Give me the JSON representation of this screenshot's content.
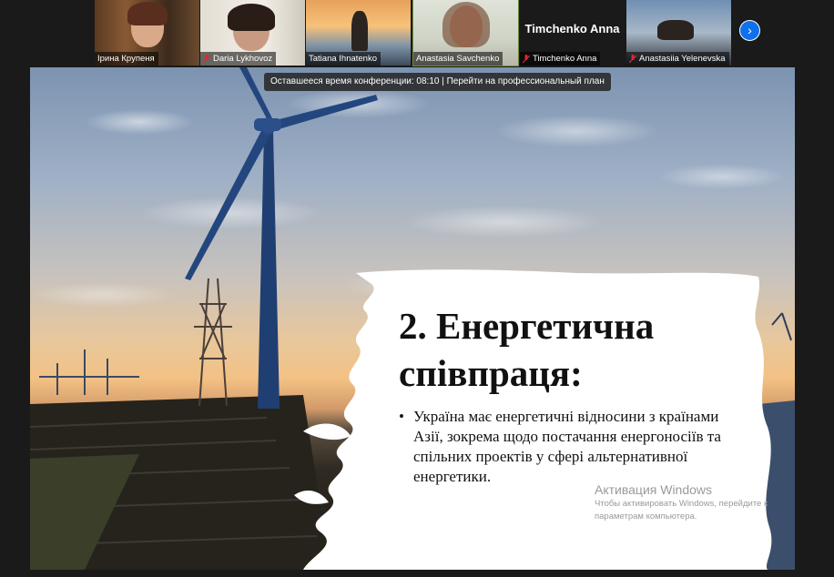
{
  "participants": [
    {
      "name": "Ірина Крупеня",
      "muted": false
    },
    {
      "name": "Daria Lykhovoz",
      "muted": true
    },
    {
      "name": "Tatiana Ihnatenko",
      "muted": false
    },
    {
      "name": "Anastasia Savchenko",
      "muted": false
    },
    {
      "name": "Timchenko Anna",
      "muted": true,
      "display_name": "Timchenko Anna"
    },
    {
      "name": "Anastasiia Yelenevska",
      "muted": true
    }
  ],
  "banner_text": "Оставшееся время конференции: 08:10 | Перейти на профессиональный план",
  "slide": {
    "title_line1": "2. Енергетична",
    "title_line2": "співпраця:",
    "bullet": "Україна має енергетичні відносини з країнами Азії, зокрема щодо постачання енергоносіїв та спільних проектів у сфері альтернативної енергетики."
  },
  "watermark": {
    "title": "Активация Windows",
    "subtitle": "Чтобы активировать Windows, перейдите к параметрам компьютера."
  },
  "icons": {
    "next": "chevron-right-icon",
    "mic": "mic-off-icon"
  },
  "colors": {
    "accent": "#0e71eb",
    "muted_icon": "#e02828",
    "active_border": "#6f8f3a"
  }
}
